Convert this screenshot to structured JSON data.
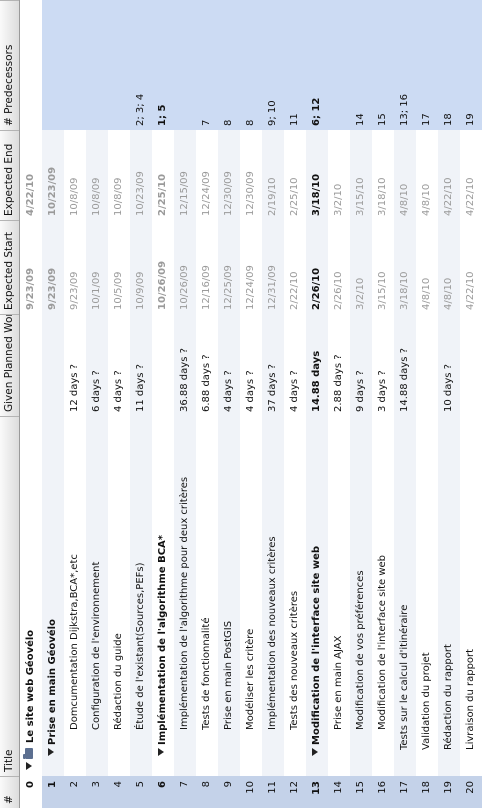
{
  "columns": {
    "num": "#",
    "title": "Title",
    "work": "Given Planned Work",
    "start": "Expected Start",
    "end": "Expected End",
    "pred": "# Predecessors"
  },
  "rows": [
    {
      "num": "0",
      "title": "Le site web Géovélo",
      "work": "",
      "start": "9/23/09",
      "end": "4/22/10",
      "pred": "",
      "level": 0,
      "kind": "root"
    },
    {
      "num": "1",
      "title": "Prise en main Géovélo",
      "work": "",
      "start": "9/23/09",
      "end": "10/23/09",
      "pred": "",
      "level": 1,
      "kind": "group"
    },
    {
      "num": "2",
      "title": "Domcumentation Dijkstra,BCA*,etc",
      "work": "12 days ?",
      "start": "9/23/09",
      "end": "10/8/09",
      "pred": "",
      "level": 2,
      "kind": "task"
    },
    {
      "num": "3",
      "title": "Configuration de l'environnement",
      "work": "6 days ?",
      "start": "10/1/09",
      "end": "10/8/09",
      "pred": "",
      "level": 2,
      "kind": "task"
    },
    {
      "num": "4",
      "title": "Rédaction du guide",
      "work": "4 days ?",
      "start": "10/5/09",
      "end": "10/8/09",
      "pred": "",
      "level": 2,
      "kind": "task"
    },
    {
      "num": "5",
      "title": "Étude de l'existant(Sources,PEFs)",
      "work": "11 days ?",
      "start": "10/9/09",
      "end": "10/23/09",
      "pred": "2; 3; 4",
      "level": 2,
      "kind": "task"
    },
    {
      "num": "6",
      "title": "Implémentation de l'algorithme BCA*",
      "work": "",
      "start": "10/26/09",
      "end": "2/25/10",
      "pred": "1; 5",
      "level": 1,
      "kind": "group"
    },
    {
      "num": "7",
      "title": "Implémentation de l'algorithme pour deux critères",
      "work": "36.88 days ?",
      "start": "10/26/09",
      "end": "12/15/09",
      "pred": "",
      "level": 2,
      "kind": "task"
    },
    {
      "num": "8",
      "title": "Tests de fonctionnalité",
      "work": "6.88 days ?",
      "start": "12/16/09",
      "end": "12/24/09",
      "pred": "7",
      "level": 2,
      "kind": "task"
    },
    {
      "num": "9",
      "title": "Prise en main PostGIS",
      "work": "4 days ?",
      "start": "12/25/09",
      "end": "12/30/09",
      "pred": "8",
      "level": 2,
      "kind": "task"
    },
    {
      "num": "10",
      "title": "Modéliser les critère",
      "work": "4 days ?",
      "start": "12/24/09",
      "end": "12/30/09",
      "pred": "8",
      "level": 2,
      "kind": "task"
    },
    {
      "num": "11",
      "title": "Implémentation des nouveaux critères",
      "work": "37 days ?",
      "start": "12/31/09",
      "end": "2/19/10",
      "pred": "9; 10",
      "level": 2,
      "kind": "task"
    },
    {
      "num": "12",
      "title": "Tests des nouveaux critères",
      "work": "4 days ?",
      "start": "2/22/10",
      "end": "2/25/10",
      "pred": "11",
      "level": 2,
      "kind": "task"
    },
    {
      "num": "13",
      "title": "Modification de l'interface site web",
      "work": "14.88 days",
      "start": "2/26/10",
      "end": "3/18/10",
      "pred": "6; 12",
      "level": 1,
      "kind": "group2"
    },
    {
      "num": "14",
      "title": "Prise en main AJAX",
      "work": "2.88 days ?",
      "start": "2/26/10",
      "end": "3/2/10",
      "pred": "",
      "level": 2,
      "kind": "task"
    },
    {
      "num": "15",
      "title": "Modification de vos préférences",
      "work": "9 days ?",
      "start": "3/2/10",
      "end": "3/15/10",
      "pred": "14",
      "level": 2,
      "kind": "task"
    },
    {
      "num": "16",
      "title": "Modification de l'interface site web",
      "work": "3 days ?",
      "start": "3/15/10",
      "end": "3/18/10",
      "pred": "15",
      "level": 2,
      "kind": "task"
    },
    {
      "num": "17",
      "title": "Tests sur le calcul d'itinéraire",
      "work": "14.88 days ?",
      "start": "3/18/10",
      "end": "4/8/10",
      "pred": "13; 16",
      "level": 1,
      "kind": "task"
    },
    {
      "num": "18",
      "title": "Validation du projet",
      "work": "",
      "start": "4/8/10",
      "end": "4/8/10",
      "pred": "17",
      "level": 1,
      "kind": "task"
    },
    {
      "num": "19",
      "title": "Rédaction du rapport",
      "work": "10 days ?",
      "start": "4/8/10",
      "end": "4/22/10",
      "pred": "18",
      "level": 1,
      "kind": "task"
    },
    {
      "num": "20",
      "title": "Livraison du rapport",
      "work": "",
      "start": "4/22/10",
      "end": "4/22/10",
      "pred": "19",
      "level": 1,
      "kind": "task"
    }
  ],
  "colors": {
    "selection_num": "#c4d2e9",
    "selection_pred": "#ccdbf3",
    "header_bg": "#e6e6e6",
    "stripe": "#f0f3f8"
  }
}
